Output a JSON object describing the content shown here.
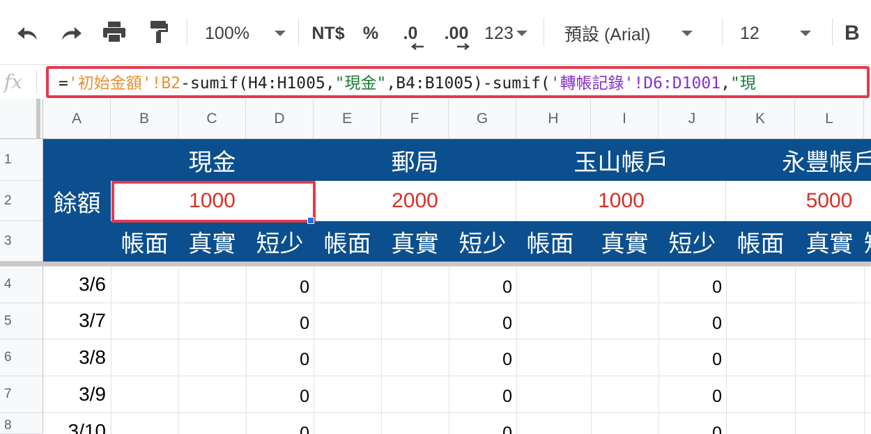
{
  "toolbar": {
    "undo_icon": "undo-icon",
    "redo_icon": "redo-icon",
    "print_icon": "print-icon",
    "paint_format_icon": "paint-format-icon",
    "zoom": "100%",
    "currency": "NT$",
    "percent": "%",
    "decrease_decimal": ".0",
    "increase_decimal": ".00",
    "more_formats": "123",
    "font": "預設 (Arial)",
    "font_size": "12",
    "bold": "B"
  },
  "formula_bar": {
    "fx_label": "fx",
    "parts": [
      "=",
      "'初始金額'!B2",
      "-sumif(H4:H1005,",
      "\"現金\"",
      ",B4:B1005)-sumif(",
      "'轉帳記錄'!D6:D1001",
      ",",
      "\"現"
    ]
  },
  "columns": [
    "A",
    "B",
    "C",
    "D",
    "E",
    "F",
    "G",
    "H",
    "I",
    "J",
    "K",
    "L"
  ],
  "rows": [
    "1",
    "2",
    "3",
    "4",
    "5",
    "6",
    "7",
    "8"
  ],
  "sheet": {
    "accounts": [
      "現金",
      "郵局",
      "玉山帳戶",
      "永豐帳戶"
    ],
    "balance_label": "餘額",
    "balances": [
      "1000",
      "2000",
      "1000",
      "5000"
    ],
    "sub_headers": [
      "帳面",
      "真實",
      "短少",
      "帳面",
      "真實",
      "短少",
      "帳面",
      "真實",
      "短少",
      "帳面",
      "真實",
      "短"
    ],
    "dates": [
      "3/6",
      "3/7",
      "3/8",
      "3/9",
      "3/10"
    ],
    "shortage_value": "0"
  },
  "colors": {
    "header_band": "#0b4f8f",
    "balance_text": "#d93025",
    "highlight": "#e5394c",
    "selection_handle": "#1a73e8"
  }
}
